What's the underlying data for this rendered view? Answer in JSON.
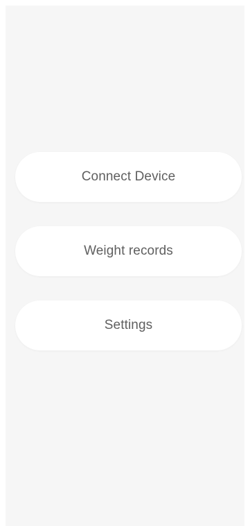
{
  "menu": {
    "items": [
      {
        "label": "Connect Device"
      },
      {
        "label": "Weight records"
      },
      {
        "label": "Settings"
      }
    ]
  },
  "colors": {
    "background": "#f6f6f6",
    "button": "#ffffff",
    "text": "#5f5f5f"
  }
}
